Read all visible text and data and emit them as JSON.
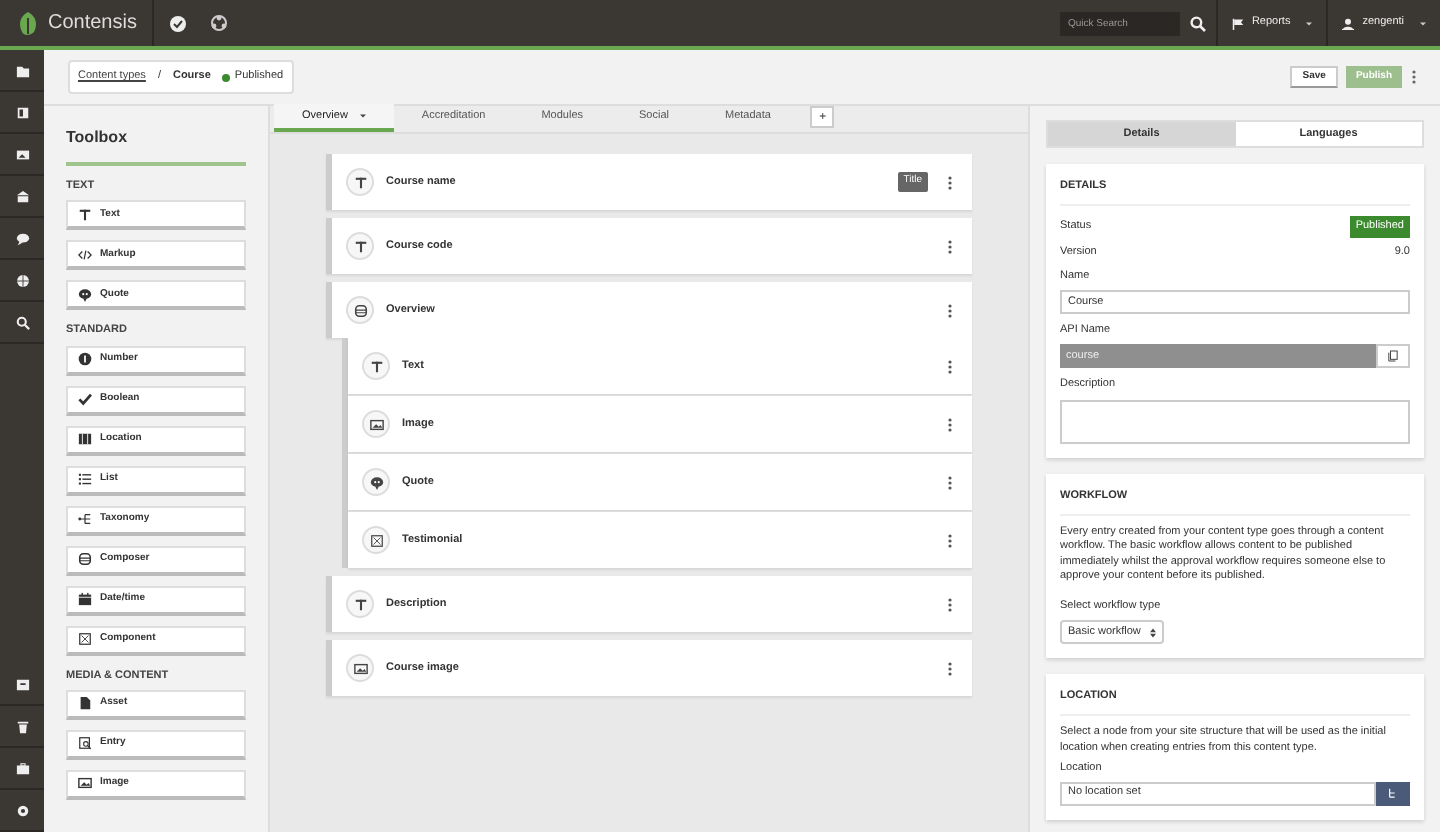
{
  "app": {
    "name": "Contensis"
  },
  "search": {
    "placeholder": "Quick Search"
  },
  "top_menu": [
    {
      "label": "Reports",
      "kind": "reports"
    },
    {
      "label": "zengenti",
      "kind": "user"
    }
  ],
  "breadcrumb": {
    "link": "Content types",
    "separator": "/",
    "current": "Course",
    "status": "Published"
  },
  "actions": {
    "save": "Save",
    "publish": "Publish",
    "publish_disabled": true
  },
  "toolbox": {
    "title": "Toolbox",
    "groups": [
      {
        "heading": "TEXT",
        "items": [
          {
            "label": "Text",
            "kind": "text"
          },
          {
            "label": "Markup",
            "kind": "markup"
          },
          {
            "label": "Quote",
            "kind": "quote"
          }
        ]
      },
      {
        "heading": "STANDARD",
        "items": [
          {
            "label": "Number",
            "kind": "number"
          },
          {
            "label": "Boolean",
            "kind": "boolean"
          },
          {
            "label": "Location",
            "kind": "location"
          },
          {
            "label": "List",
            "kind": "list"
          },
          {
            "label": "Taxonomy",
            "kind": "taxonomy"
          },
          {
            "label": "Composer",
            "kind": "composer"
          },
          {
            "label": "Date/time",
            "kind": "datetime"
          },
          {
            "label": "Component",
            "kind": "component"
          }
        ]
      },
      {
        "heading": "MEDIA & CONTENT",
        "items": [
          {
            "label": "Asset",
            "kind": "asset"
          },
          {
            "label": "Entry",
            "kind": "entry"
          },
          {
            "label": "Image",
            "kind": "image"
          }
        ]
      }
    ]
  },
  "tabs": [
    {
      "label": "Overview",
      "selected": true,
      "dropdown": true
    },
    {
      "label": "Accreditation",
      "selected": false,
      "dropdown": false
    },
    {
      "label": "Modules",
      "selected": false,
      "dropdown": false
    },
    {
      "label": "Social",
      "selected": false,
      "dropdown": false
    },
    {
      "label": "Metadata",
      "selected": false,
      "dropdown": false
    }
  ],
  "add_tab": "+",
  "fields": [
    {
      "label": "Course name",
      "kind": "text",
      "badge": "Title"
    },
    {
      "label": "Course code",
      "kind": "text"
    },
    {
      "label": "Overview",
      "kind": "composer",
      "children": [
        {
          "label": "Text",
          "kind": "text"
        },
        {
          "label": "Image",
          "kind": "image"
        },
        {
          "label": "Quote",
          "kind": "quote"
        },
        {
          "label": "Testimonial",
          "kind": "component"
        }
      ]
    },
    {
      "label": "Description",
      "kind": "text"
    },
    {
      "label": "Course image",
      "kind": "image"
    }
  ],
  "panel_tabs": [
    {
      "label": "Details",
      "selected": true
    },
    {
      "label": "Languages",
      "selected": false
    }
  ],
  "details": {
    "heading": "DETAILS",
    "status_label": "Status",
    "status": "Published",
    "version_label": "Version",
    "version": "9.0",
    "name_label": "Name",
    "name": "Course",
    "api_label": "API Name",
    "api_value": "course",
    "description_label": "Description"
  },
  "workflow": {
    "heading": "WORKFLOW",
    "text": "Every entry created from your content type goes through a content workflow. The basic workflow allows content to be published immediately whilst the approval workflow requires someone else to approve your content before its published.",
    "select_label": "Select workflow type",
    "select_value": "Basic workflow"
  },
  "location": {
    "heading": "LOCATION",
    "text": "Select a node from your site structure that will be used as the initial location when creating entries from this content type.",
    "field_label": "Location",
    "field_value": "No location set"
  }
}
